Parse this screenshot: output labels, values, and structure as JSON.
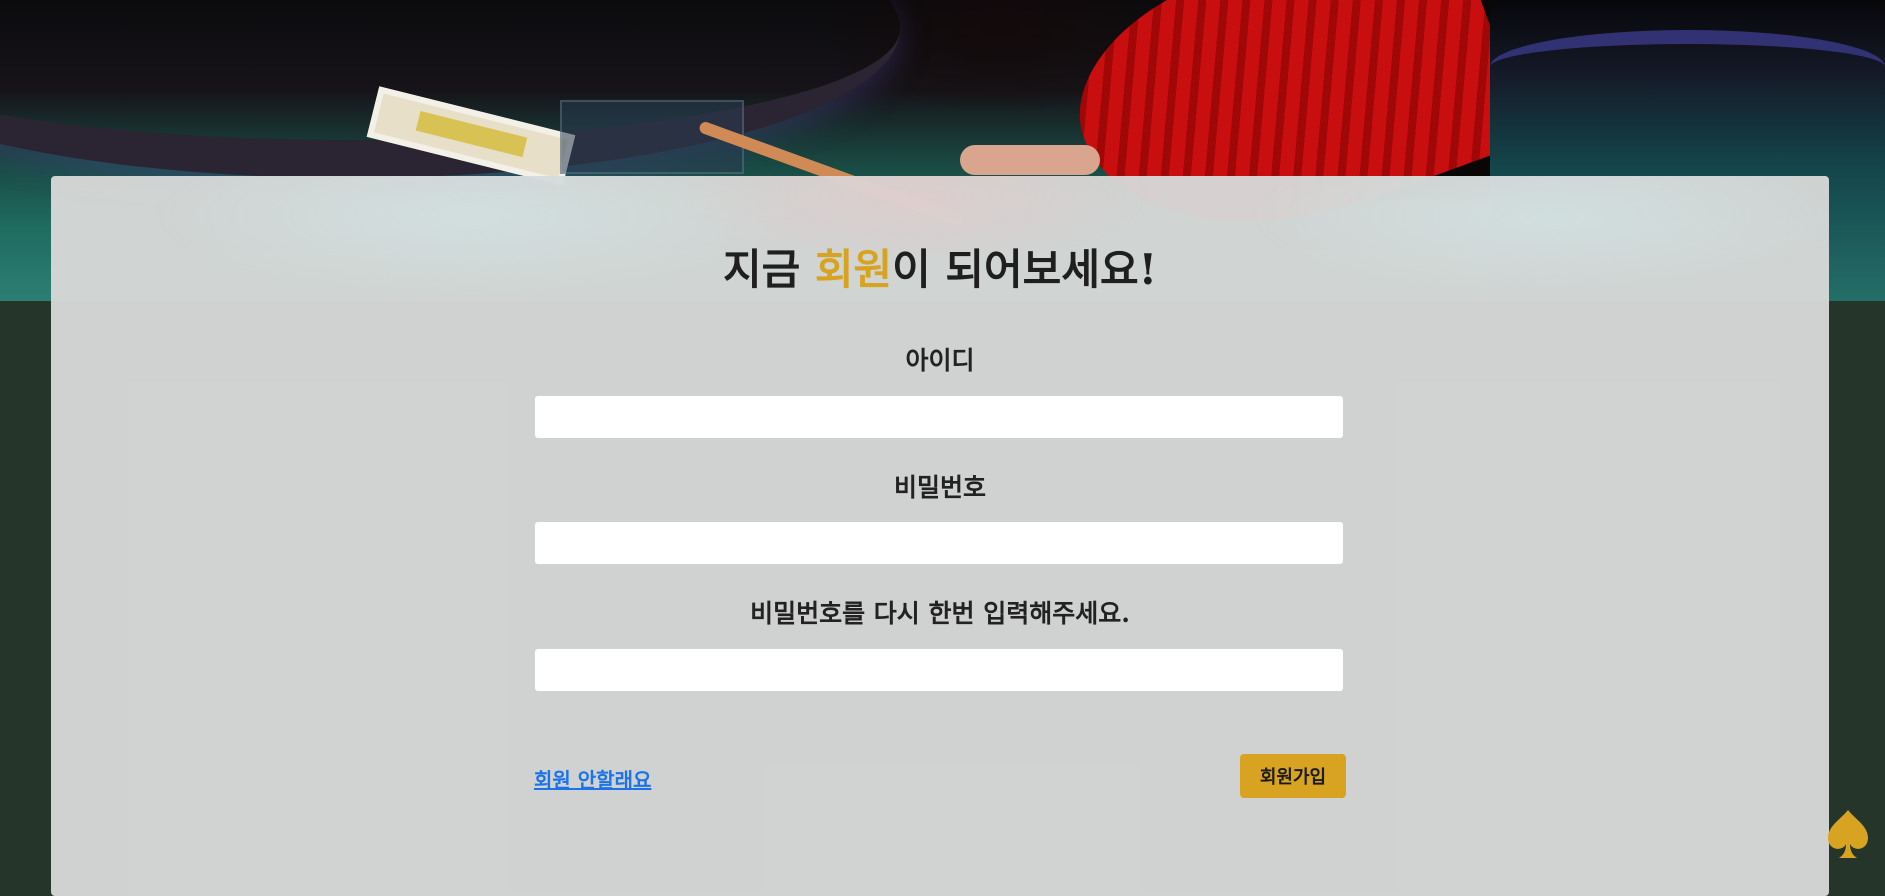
{
  "header": {
    "title_prefix": "지금 ",
    "title_accent": "회원",
    "title_suffix": "이 되어보세요!"
  },
  "form": {
    "id_label": "아이디",
    "id_value": "",
    "password_label": "비밀번호",
    "password_value": "",
    "confirm_label": "비밀번호를 다시 한번 입력해주세요.",
    "confirm_value": ""
  },
  "actions": {
    "decline_link": "회원 안할래요",
    "signup_button": "회원가입"
  },
  "icons": {
    "corner_icon": "spade-icon"
  },
  "colors": {
    "accent": "#d9a322",
    "link": "#1a73e8",
    "background": "#25352a",
    "panel": "#d6d8d7"
  }
}
